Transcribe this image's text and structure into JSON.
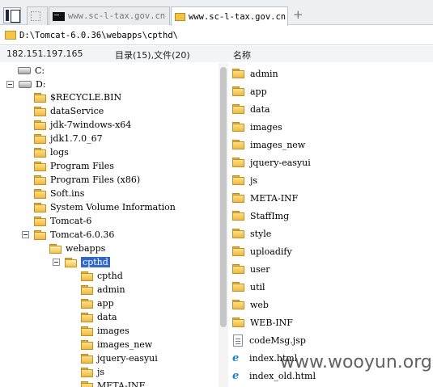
{
  "tabs": {
    "tab1_title": "www.sc-l-tax.gov.cn",
    "tab2_title": "www.sc-l-tax.gov.cn",
    "new_tab_label": "+"
  },
  "path": "D:\\Tomcat-6.0.36\\webapps\\cpthd\\",
  "info": {
    "ip": "182.151.197.165",
    "count": "目录(15),文件(20)",
    "column_name": "名称"
  },
  "tree": {
    "drive_c": "C:",
    "drive_d": "D:",
    "d_children": [
      "$RECYCLE.BIN",
      "dataService",
      "jdk-7windows-x64",
      "jdk1.7.0_67",
      "logs",
      "Program Files",
      "Program Files (x86)",
      "Soft.ins",
      "System Volume Information",
      "Tomcat-6",
      "Tomcat-6.0.36"
    ],
    "webapps": "webapps",
    "cpthd": "cpthd",
    "cpthd_children": [
      "cpthd",
      "admin",
      "app",
      "data",
      "images",
      "images_new",
      "jquery-easyui",
      "js",
      "META-INF"
    ]
  },
  "files": {
    "folders": [
      "admin",
      "app",
      "data",
      "images",
      "images_new",
      "jquery-easyui",
      "js",
      "META-INF",
      "StaffImg",
      "style",
      "uploadify",
      "user",
      "util",
      "web",
      "WEB-INF"
    ],
    "jsp_file": "codeMsg.jsp",
    "html_files": [
      "index.html",
      "index_old.html"
    ]
  },
  "watermark": "www.wooyun.org"
}
